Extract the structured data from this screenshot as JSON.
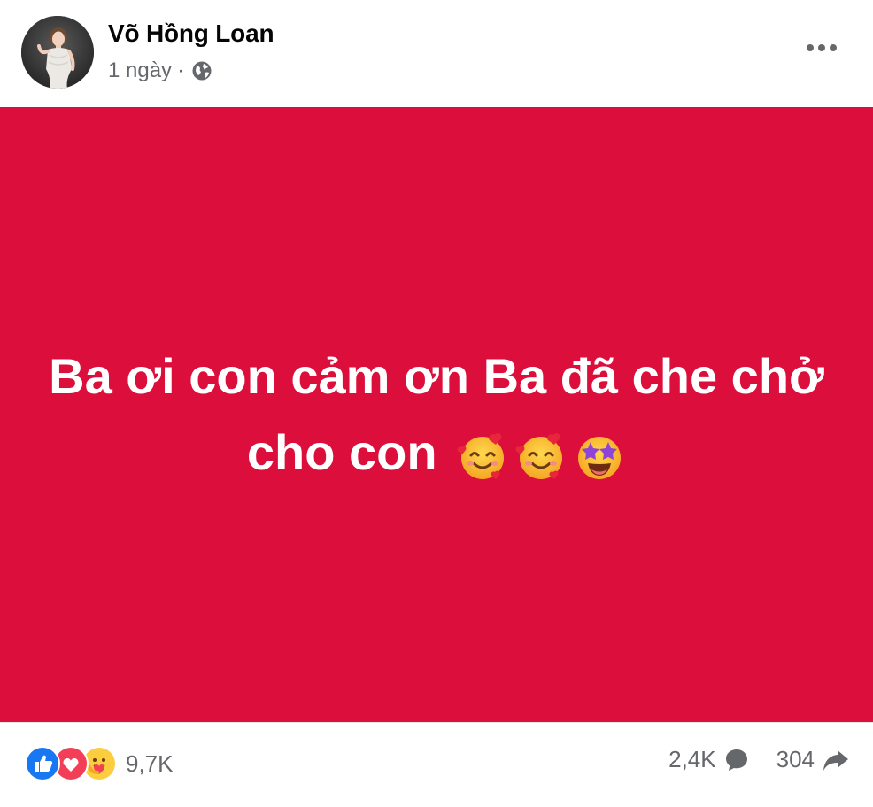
{
  "post": {
    "author": "Võ Hồng Loan",
    "time": "1 ngày",
    "separator": "·",
    "privacy_icon": "globe-icon",
    "more_icon": "more-options-icon",
    "background_color": "#DC0F3C",
    "status_text": "Ba ơi con cảm ơn Ba đã che chở cho con",
    "emojis": [
      "smiling-face-with-hearts",
      "smiling-face-with-hearts",
      "star-struck"
    ]
  },
  "footer": {
    "reaction_icons": [
      "like-icon",
      "love-icon",
      "care-icon"
    ],
    "reaction_count": "9,7K",
    "comment_count": "2,4K",
    "share_count": "304"
  },
  "colors": {
    "like": "#1877F2",
    "love": "#F33E58",
    "muted": "#65676B"
  }
}
